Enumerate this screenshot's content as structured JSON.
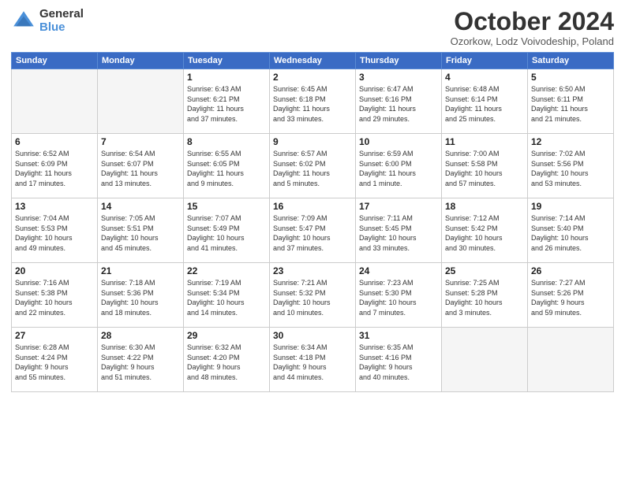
{
  "logo": {
    "general": "General",
    "blue": "Blue"
  },
  "title": "October 2024",
  "subtitle": "Ozorkow, Lodz Voivodeship, Poland",
  "days_of_week": [
    "Sunday",
    "Monday",
    "Tuesday",
    "Wednesday",
    "Thursday",
    "Friday",
    "Saturday"
  ],
  "weeks": [
    [
      {
        "day": "",
        "info": ""
      },
      {
        "day": "",
        "info": ""
      },
      {
        "day": "1",
        "info": "Sunrise: 6:43 AM\nSunset: 6:21 PM\nDaylight: 11 hours\nand 37 minutes."
      },
      {
        "day": "2",
        "info": "Sunrise: 6:45 AM\nSunset: 6:18 PM\nDaylight: 11 hours\nand 33 minutes."
      },
      {
        "day": "3",
        "info": "Sunrise: 6:47 AM\nSunset: 6:16 PM\nDaylight: 11 hours\nand 29 minutes."
      },
      {
        "day": "4",
        "info": "Sunrise: 6:48 AM\nSunset: 6:14 PM\nDaylight: 11 hours\nand 25 minutes."
      },
      {
        "day": "5",
        "info": "Sunrise: 6:50 AM\nSunset: 6:11 PM\nDaylight: 11 hours\nand 21 minutes."
      }
    ],
    [
      {
        "day": "6",
        "info": "Sunrise: 6:52 AM\nSunset: 6:09 PM\nDaylight: 11 hours\nand 17 minutes."
      },
      {
        "day": "7",
        "info": "Sunrise: 6:54 AM\nSunset: 6:07 PM\nDaylight: 11 hours\nand 13 minutes."
      },
      {
        "day": "8",
        "info": "Sunrise: 6:55 AM\nSunset: 6:05 PM\nDaylight: 11 hours\nand 9 minutes."
      },
      {
        "day": "9",
        "info": "Sunrise: 6:57 AM\nSunset: 6:02 PM\nDaylight: 11 hours\nand 5 minutes."
      },
      {
        "day": "10",
        "info": "Sunrise: 6:59 AM\nSunset: 6:00 PM\nDaylight: 11 hours\nand 1 minute."
      },
      {
        "day": "11",
        "info": "Sunrise: 7:00 AM\nSunset: 5:58 PM\nDaylight: 10 hours\nand 57 minutes."
      },
      {
        "day": "12",
        "info": "Sunrise: 7:02 AM\nSunset: 5:56 PM\nDaylight: 10 hours\nand 53 minutes."
      }
    ],
    [
      {
        "day": "13",
        "info": "Sunrise: 7:04 AM\nSunset: 5:53 PM\nDaylight: 10 hours\nand 49 minutes."
      },
      {
        "day": "14",
        "info": "Sunrise: 7:05 AM\nSunset: 5:51 PM\nDaylight: 10 hours\nand 45 minutes."
      },
      {
        "day": "15",
        "info": "Sunrise: 7:07 AM\nSunset: 5:49 PM\nDaylight: 10 hours\nand 41 minutes."
      },
      {
        "day": "16",
        "info": "Sunrise: 7:09 AM\nSunset: 5:47 PM\nDaylight: 10 hours\nand 37 minutes."
      },
      {
        "day": "17",
        "info": "Sunrise: 7:11 AM\nSunset: 5:45 PM\nDaylight: 10 hours\nand 33 minutes."
      },
      {
        "day": "18",
        "info": "Sunrise: 7:12 AM\nSunset: 5:42 PM\nDaylight: 10 hours\nand 30 minutes."
      },
      {
        "day": "19",
        "info": "Sunrise: 7:14 AM\nSunset: 5:40 PM\nDaylight: 10 hours\nand 26 minutes."
      }
    ],
    [
      {
        "day": "20",
        "info": "Sunrise: 7:16 AM\nSunset: 5:38 PM\nDaylight: 10 hours\nand 22 minutes."
      },
      {
        "day": "21",
        "info": "Sunrise: 7:18 AM\nSunset: 5:36 PM\nDaylight: 10 hours\nand 18 minutes."
      },
      {
        "day": "22",
        "info": "Sunrise: 7:19 AM\nSunset: 5:34 PM\nDaylight: 10 hours\nand 14 minutes."
      },
      {
        "day": "23",
        "info": "Sunrise: 7:21 AM\nSunset: 5:32 PM\nDaylight: 10 hours\nand 10 minutes."
      },
      {
        "day": "24",
        "info": "Sunrise: 7:23 AM\nSunset: 5:30 PM\nDaylight: 10 hours\nand 7 minutes."
      },
      {
        "day": "25",
        "info": "Sunrise: 7:25 AM\nSunset: 5:28 PM\nDaylight: 10 hours\nand 3 minutes."
      },
      {
        "day": "26",
        "info": "Sunrise: 7:27 AM\nSunset: 5:26 PM\nDaylight: 9 hours\nand 59 minutes."
      }
    ],
    [
      {
        "day": "27",
        "info": "Sunrise: 6:28 AM\nSunset: 4:24 PM\nDaylight: 9 hours\nand 55 minutes."
      },
      {
        "day": "28",
        "info": "Sunrise: 6:30 AM\nSunset: 4:22 PM\nDaylight: 9 hours\nand 51 minutes."
      },
      {
        "day": "29",
        "info": "Sunrise: 6:32 AM\nSunset: 4:20 PM\nDaylight: 9 hours\nand 48 minutes."
      },
      {
        "day": "30",
        "info": "Sunrise: 6:34 AM\nSunset: 4:18 PM\nDaylight: 9 hours\nand 44 minutes."
      },
      {
        "day": "31",
        "info": "Sunrise: 6:35 AM\nSunset: 4:16 PM\nDaylight: 9 hours\nand 40 minutes."
      },
      {
        "day": "",
        "info": ""
      },
      {
        "day": "",
        "info": ""
      }
    ]
  ]
}
